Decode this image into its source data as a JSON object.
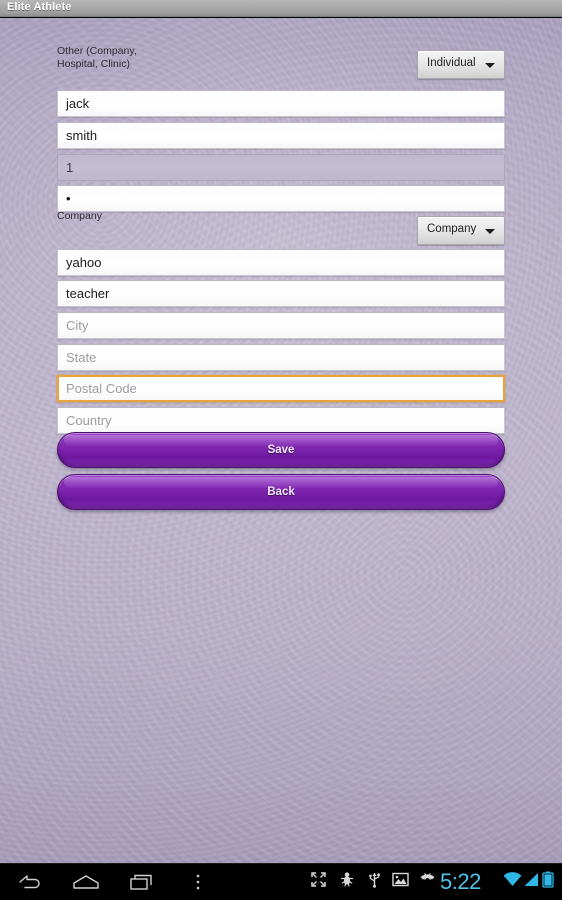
{
  "window": {
    "title": "Elite Athlete"
  },
  "form": {
    "section_one": {
      "label": "Other (Company,\nHospital, Clinic)",
      "spinner_value": "Individual",
      "spinner_icon": "chevron-down-icon"
    },
    "section_two": {
      "label": "Company",
      "spinner_value": "Company",
      "spinner_icon": "chevron-down-icon"
    },
    "fields": [
      {
        "name": "first-name",
        "value": "jack",
        "placeholder": "",
        "state": "filled",
        "type": "text"
      },
      {
        "name": "last-name",
        "value": "smith",
        "placeholder": "",
        "state": "filled",
        "type": "text"
      },
      {
        "name": "id-number",
        "value": "1",
        "placeholder": "",
        "state": "disabled",
        "type": "text"
      },
      {
        "name": "password",
        "value": "•",
        "placeholder": "",
        "state": "filled",
        "type": "password"
      },
      {
        "name": "email",
        "value": "yahoo",
        "placeholder": "",
        "state": "filled",
        "type": "text"
      },
      {
        "name": "occupation",
        "value": "teacher",
        "placeholder": "",
        "state": "filled",
        "type": "text"
      },
      {
        "name": "city",
        "value": "",
        "placeholder": "City",
        "state": "empty",
        "type": "text"
      },
      {
        "name": "state",
        "value": "",
        "placeholder": "State",
        "state": "empty",
        "type": "text"
      },
      {
        "name": "postal-code",
        "value": "",
        "placeholder": "Postal Code",
        "state": "focused",
        "type": "text"
      },
      {
        "name": "country",
        "value": "",
        "placeholder": "Country",
        "state": "empty",
        "type": "text"
      }
    ],
    "buttons": {
      "save_label": "Save",
      "back_label": "Back"
    }
  },
  "system_bar": {
    "nav": [
      {
        "name": "back-icon",
        "label": "Back"
      },
      {
        "name": "home-icon",
        "label": "Home"
      },
      {
        "name": "recents-icon",
        "label": "Recent apps"
      },
      {
        "name": "overflow-menu-icon",
        "label": "Menu"
      }
    ],
    "status_icons": [
      "fullscreen-icon",
      "android-debug-icon",
      "usb-icon",
      "screenshot-image-icon",
      "missed-call-icon"
    ],
    "clock": "5:22",
    "right_icons": [
      "wifi-icon",
      "cellular-signal-icon",
      "battery-icon"
    ]
  },
  "colors": {
    "accent_purple": "#7d24ae",
    "focus_orange": "#e8a33d",
    "status_cyan": "#4fc3e8",
    "background_lavender": "#bdb4cd",
    "titlebar_gray": "#a9a9a9"
  }
}
